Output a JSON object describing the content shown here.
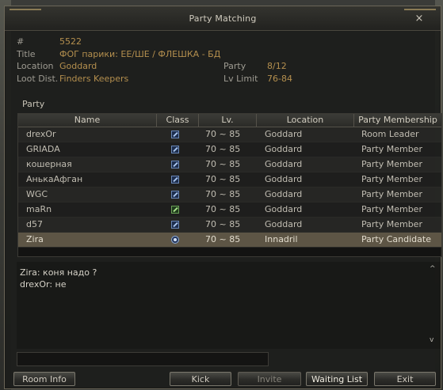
{
  "window": {
    "title": "Party Matching",
    "close_label": "×"
  },
  "room": {
    "number_label": "#",
    "number": "5522",
    "title_label": "Title",
    "title": "ФОГ парики: ЕЕ/ШЕ / ФЛЕШКА - БД",
    "location_label": "Location",
    "location": "Goddard",
    "loot_label": "Loot Dist.",
    "loot": "Finders Keepers",
    "party_label": "Party",
    "party": "8/12",
    "lvlimit_label": "Lv Limit",
    "lvlimit": "76-84"
  },
  "party_section_label": "Party",
  "table": {
    "headers": [
      "Name",
      "Class",
      "Lv.",
      "Location",
      "Party Membership"
    ],
    "rows": [
      {
        "name": "drexOr",
        "class_icon": "blue-sword-icon",
        "lv": "70 ~ 85",
        "location": "Goddard",
        "membership": "Room Leader"
      },
      {
        "name": "GRIADA",
        "class_icon": "blue-sword-icon",
        "lv": "70 ~ 85",
        "location": "Goddard",
        "membership": "Party Member"
      },
      {
        "name": "кошерная",
        "class_icon": "blue-sword-icon",
        "lv": "70 ~ 85",
        "location": "Goddard",
        "membership": "Party Member"
      },
      {
        "name": "АнькаАфган",
        "class_icon": "blue-sword-icon",
        "lv": "70 ~ 85",
        "location": "Goddard",
        "membership": "Party Member"
      },
      {
        "name": "WGC",
        "class_icon": "blue-sword-icon",
        "lv": "70 ~ 85",
        "location": "Goddard",
        "membership": "Party Member"
      },
      {
        "name": "maRn",
        "class_icon": "green-staff-icon",
        "lv": "70 ~ 85",
        "location": "Goddard",
        "membership": "Party Member"
      },
      {
        "name": "d57",
        "class_icon": "blue-sword-icon",
        "lv": "70 ~ 85",
        "location": "Goddard",
        "membership": "Party Member"
      },
      {
        "name": "Zira",
        "class_icon": "blue-orb-icon",
        "lv": "70 ~ 85",
        "location": "Innadril",
        "membership": "Party Candidate"
      }
    ]
  },
  "chat": {
    "lines": [
      "Zira: коня надо ?",
      "drexOr: не"
    ],
    "input_value": "",
    "scroll_up": "^",
    "scroll_down": "v"
  },
  "buttons": {
    "room_info": "Room Info",
    "kick": "Kick",
    "invite": "Invite",
    "waiting_list": "Waiting List",
    "exit": "Exit"
  }
}
